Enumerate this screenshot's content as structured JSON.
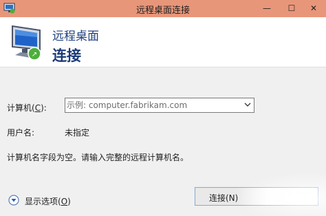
{
  "window": {
    "title": "远程桌面连接",
    "minimize_glyph": "—",
    "maximize_glyph": "☐",
    "close_glyph": "✕"
  },
  "header": {
    "line1": "远程桌面",
    "line2": "连接"
  },
  "form": {
    "computer_label": "计算机(",
    "computer_accel": "C",
    "computer_label_end": "):",
    "computer_placeholder": "示例: computer.fabrikam.com",
    "username_label": "用户名:",
    "username_value": "未指定",
    "status_message": "计算机名字段为空。请输入完整的远程计算机名。"
  },
  "footer": {
    "options_label": "显示选项(",
    "options_accel": "O",
    "options_label_end": ")",
    "connect_label": "连接(N)"
  },
  "colors": {
    "titlebar": "#e8967a",
    "header_text": "#1a3a78",
    "background": "#f0f0f0"
  }
}
